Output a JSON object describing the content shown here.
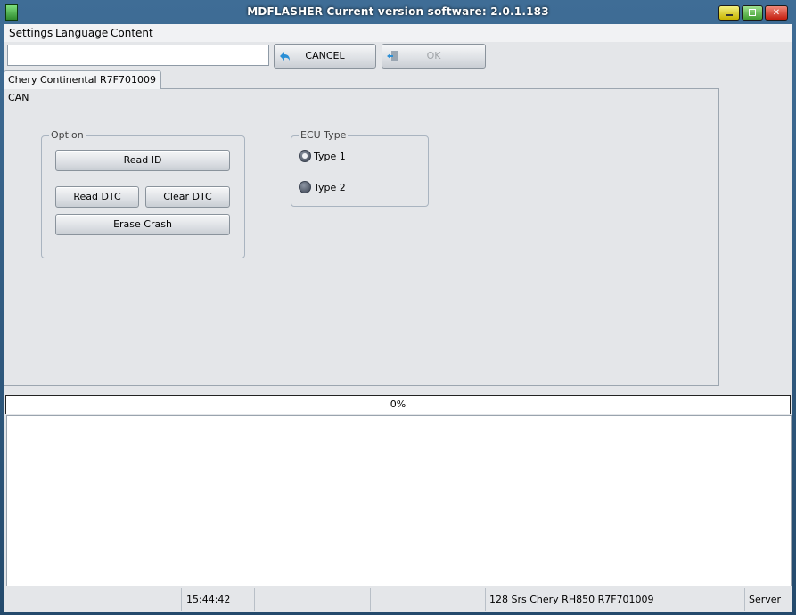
{
  "window": {
    "title": "MDFLASHER  Current version software: 2.0.1.183"
  },
  "menu": {
    "items": [
      "Settings",
      "Language",
      "Content"
    ]
  },
  "toolbar": {
    "path_value": "",
    "cancel_label": "CANCEL",
    "ok_label": "OK"
  },
  "tabs": [
    {
      "label": "Chery Continental R7F701009 CAN",
      "active": true
    }
  ],
  "option_group": {
    "title": "Option",
    "read_id_label": "Read ID",
    "read_dtc_label": "Read DTC",
    "clear_dtc_label": "Clear DTC",
    "erase_crash_label": "Erase Crash"
  },
  "ecu_group": {
    "title": "ECU Type",
    "options": [
      {
        "label": "Type 1",
        "checked": true
      },
      {
        "label": "Type 2",
        "checked": false
      }
    ]
  },
  "progress": {
    "value": 0,
    "label": "0%"
  },
  "log": {
    "lines": []
  },
  "statusbar": {
    "time": "15:44:42",
    "device": "128 Srs Chery RH850 R7F701009",
    "mode": "Server"
  },
  "colors": {
    "title_bar": "#244a6c",
    "client_bg": "#e4e6e9",
    "progress_fill": "#3a8ee6"
  }
}
